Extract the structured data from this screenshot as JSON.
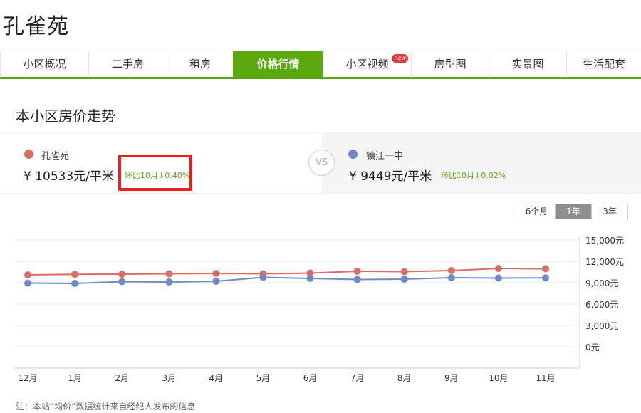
{
  "page": {
    "title": "孔雀苑"
  },
  "tabs": [
    {
      "label": "小区概况",
      "active": false,
      "badge": ""
    },
    {
      "label": "二手房",
      "active": false,
      "badge": ""
    },
    {
      "label": "租房",
      "active": false,
      "badge": ""
    },
    {
      "label": "价格行情",
      "active": true,
      "badge": ""
    },
    {
      "label": "小区视频",
      "active": false,
      "badge": "new"
    },
    {
      "label": "房型图",
      "active": false,
      "badge": ""
    },
    {
      "label": "实景图",
      "active": false,
      "badge": ""
    },
    {
      "label": "生活配套",
      "active": false,
      "badge": ""
    }
  ],
  "section": {
    "title": "本小区房价走势"
  },
  "compare": {
    "left": {
      "name": "孔雀苑",
      "price": "¥  10533元/平米",
      "change": "环比10月↓0.40%",
      "color": "#dd6b66"
    },
    "vs": "VS",
    "right": {
      "name": "镇江一中",
      "price": "¥  9449元/平米",
      "change": "环比10月↓0.02%",
      "color": "#6e8bc8"
    }
  },
  "range_buttons": [
    {
      "label": "6个月",
      "active": false
    },
    {
      "label": "1年",
      "active": true
    },
    {
      "label": "3年",
      "active": false
    }
  ],
  "chart_data": {
    "type": "line",
    "categories": [
      "12月",
      "1月",
      "2月",
      "3月",
      "4月",
      "5月",
      "6月",
      "7月",
      "8月",
      "9月",
      "10月",
      "11月"
    ],
    "y_ticks": [
      "15,000元",
      "12,000元",
      "9,000元",
      "6,000元",
      "3,000元",
      "0元"
    ],
    "ylim": [
      0,
      15000
    ],
    "grid": true,
    "series": [
      {
        "name": "孔雀苑",
        "color": "#dd6b66",
        "values": [
          10100,
          10180,
          10200,
          10250,
          10300,
          10250,
          10350,
          10600,
          10550,
          10700,
          11000,
          10950
        ]
      },
      {
        "name": "镇江一中",
        "color": "#6e8bc8",
        "values": [
          8950,
          8900,
          9150,
          9100,
          9200,
          9750,
          9600,
          9450,
          9500,
          9700,
          9650,
          9680
        ]
      }
    ]
  },
  "note": "注：本站“均价”数据统计来自经纪人发布的信息"
}
